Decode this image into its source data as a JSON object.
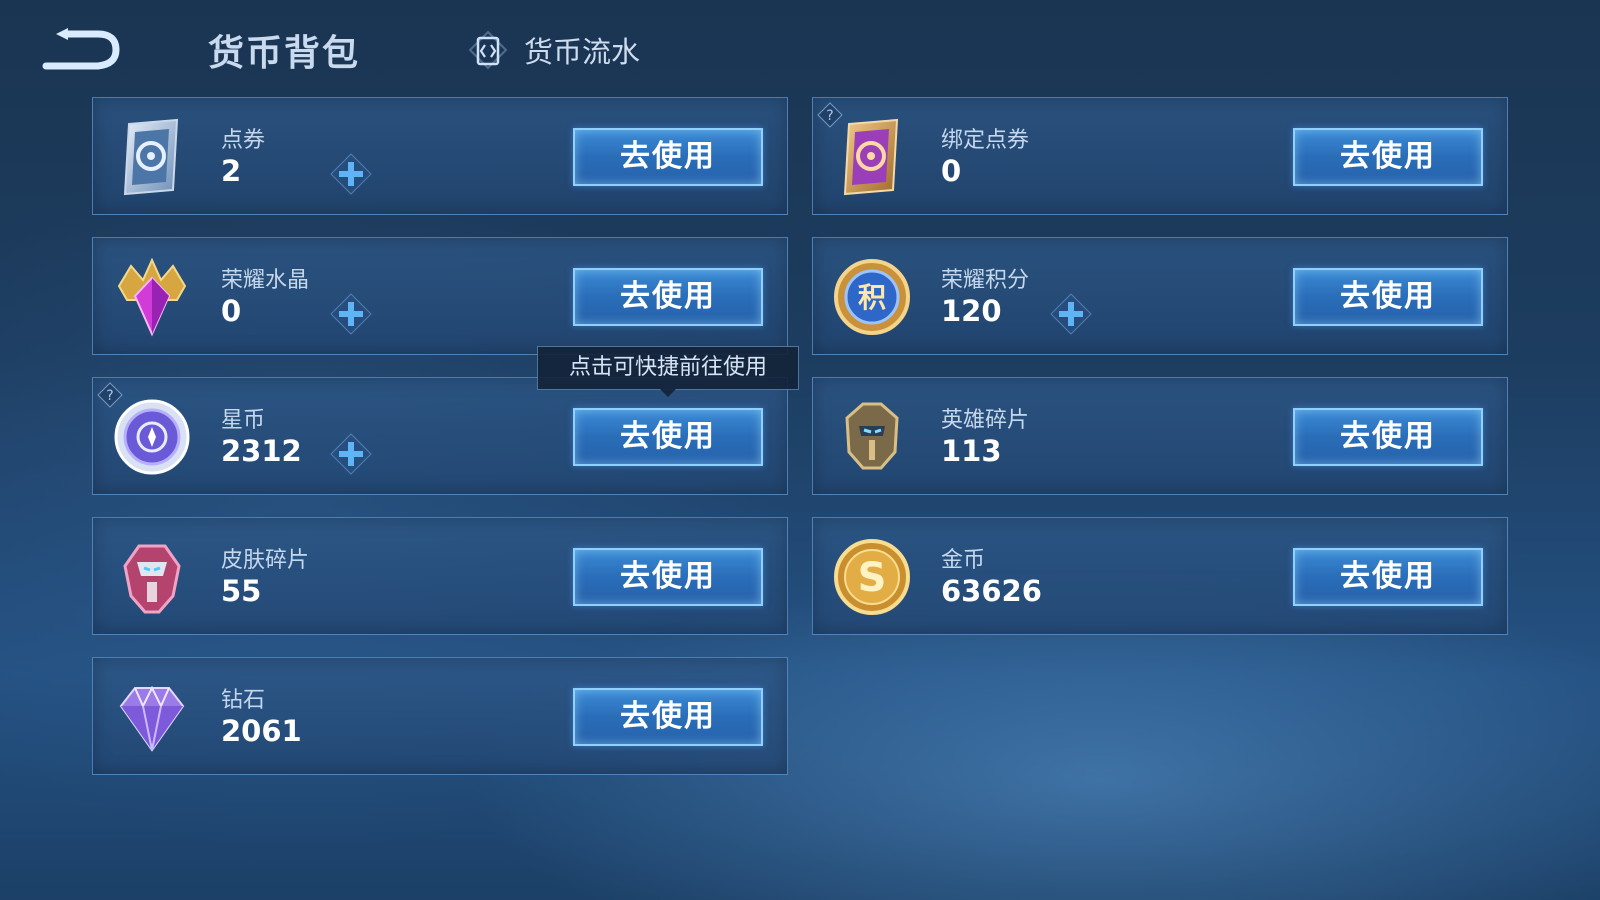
{
  "header": {
    "title": "货币背包",
    "flow_tab_label": "货币流水"
  },
  "tooltip": "点击可快捷前往使用",
  "currencies": [
    {
      "name": "点券",
      "value": "2",
      "has_plus": true,
      "icon": "coupon-card-icon",
      "button": "去使用"
    },
    {
      "name": "绑定点券",
      "value": "0",
      "has_plus": false,
      "has_help": true,
      "icon": "bound-coupon-card-icon",
      "button": "去使用"
    },
    {
      "name": "荣耀水晶",
      "value": "0",
      "has_plus": true,
      "icon": "glory-crystal-icon",
      "button": "去使用"
    },
    {
      "name": "荣耀积分",
      "value": "120",
      "has_plus": true,
      "icon": "glory-points-coin-icon",
      "button": "去使用"
    },
    {
      "name": "星币",
      "value": "2312",
      "has_plus": true,
      "has_help": true,
      "icon": "star-coin-icon",
      "button": "去使用"
    },
    {
      "name": "英雄碎片",
      "value": "113",
      "has_plus": false,
      "icon": "hero-fragment-icon",
      "button": "去使用"
    },
    {
      "name": "皮肤碎片",
      "value": "55",
      "has_plus": false,
      "icon": "skin-fragment-icon",
      "button": "去使用"
    },
    {
      "name": "金币",
      "value": "63626",
      "has_plus": false,
      "icon": "gold-coin-icon",
      "button": "去使用"
    },
    {
      "name": "钻石",
      "value": "2061",
      "has_plus": false,
      "icon": "diamond-icon",
      "button": "去使用"
    }
  ],
  "colors": {
    "accent": "#3b8bd6",
    "plus_icon": "#5fb4f5",
    "card_border": "#6eaae6"
  }
}
